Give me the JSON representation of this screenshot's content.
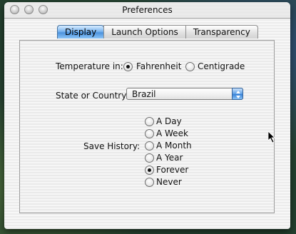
{
  "window": {
    "title": "Preferences"
  },
  "tabs": [
    {
      "label": "Display",
      "active": true
    },
    {
      "label": "Launch Options",
      "active": false
    },
    {
      "label": "Transparency",
      "active": false
    }
  ],
  "temperature": {
    "label": "Temperature in:",
    "options": [
      {
        "label": "Fahrenheit",
        "checked": true
      },
      {
        "label": "Centigrade",
        "checked": false
      }
    ]
  },
  "location": {
    "label": "State or Country:",
    "selected": "Brazil"
  },
  "history": {
    "label": "Save History:",
    "options": [
      {
        "label": "A Day",
        "checked": false
      },
      {
        "label": "A Week",
        "checked": false
      },
      {
        "label": "A Month",
        "checked": false
      },
      {
        "label": "A Year",
        "checked": false
      },
      {
        "label": "Forever",
        "checked": true
      },
      {
        "label": "Never",
        "checked": false
      }
    ]
  },
  "colors": {
    "accent": "#4c92dd",
    "close": "#cfcfcf"
  }
}
